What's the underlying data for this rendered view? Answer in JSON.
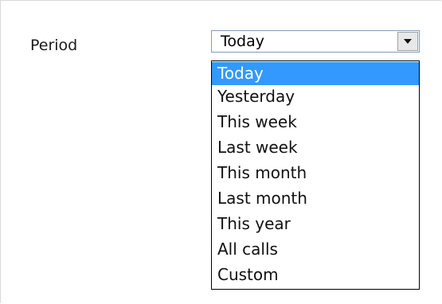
{
  "form": {
    "period_label": "Period",
    "period_select": {
      "value": "Today",
      "button_icon": "chevron-down-icon",
      "options": [
        "Today",
        "Yesterday",
        "This week",
        "Last week",
        "This month",
        "Last month",
        "This year",
        "All calls",
        "Custom"
      ],
      "highlighted_option": "Today"
    }
  },
  "colors": {
    "highlight": "#3399ff",
    "select_border": "#7f9db9",
    "list_border": "#000000"
  }
}
